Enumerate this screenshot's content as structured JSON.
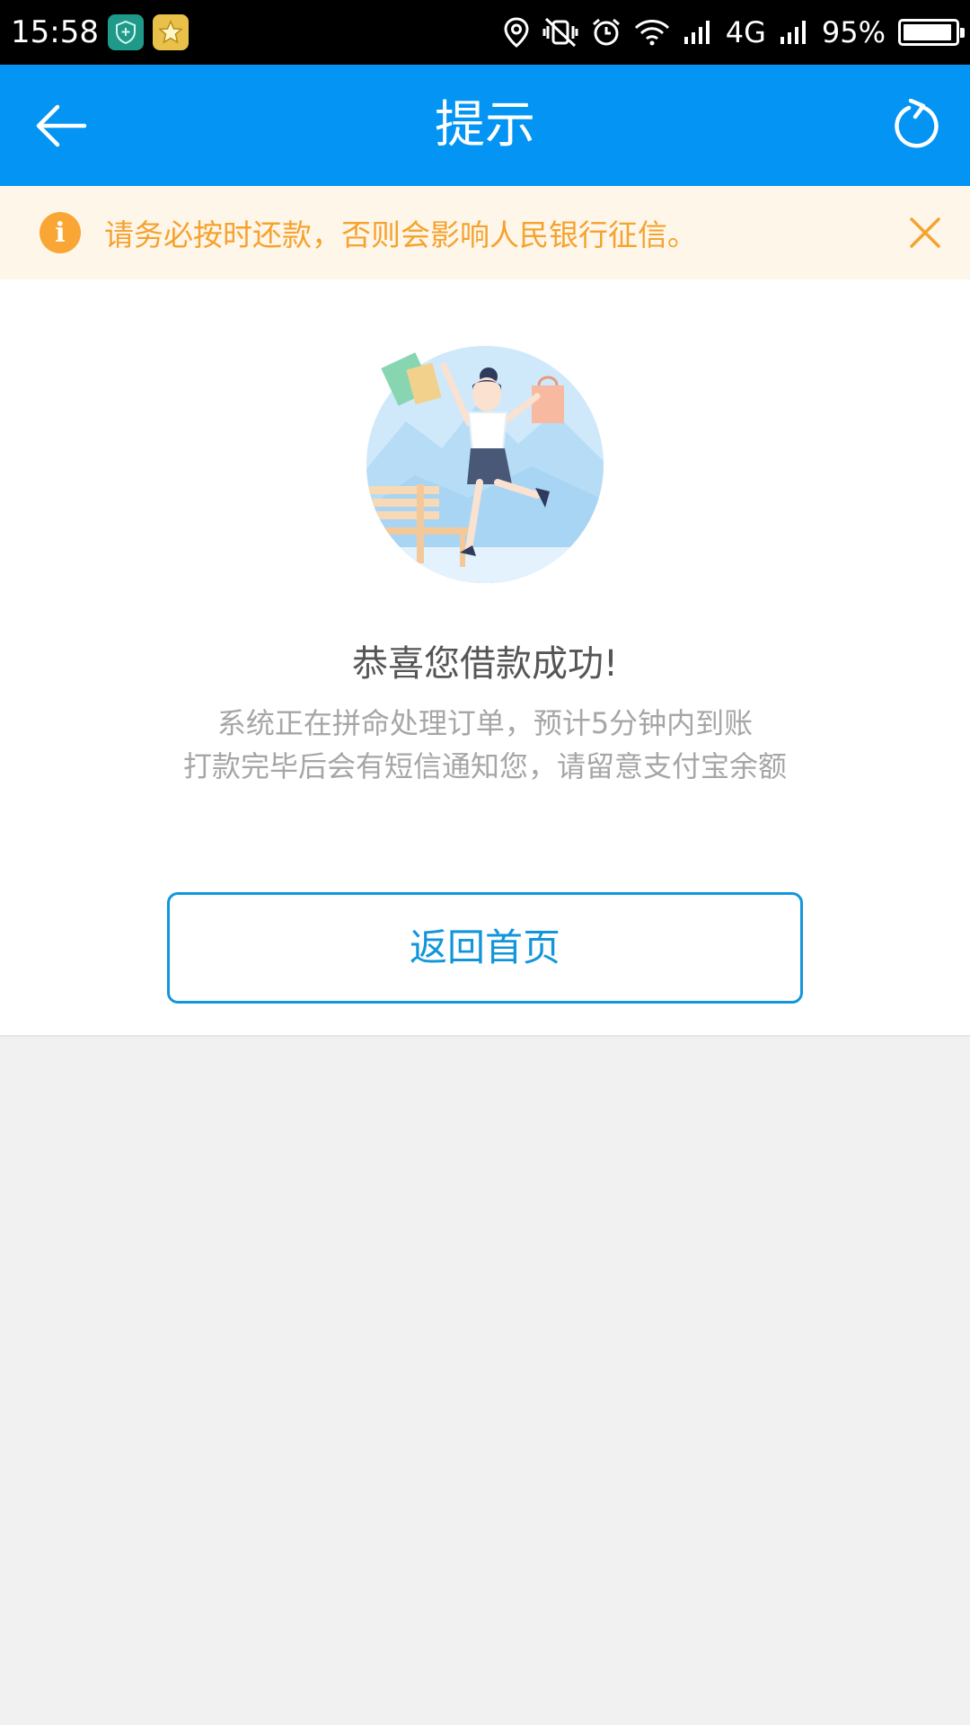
{
  "status_bar": {
    "time": "15:58",
    "network": "4G",
    "battery_text": "95%",
    "battery_level": 0.95,
    "icons": [
      "shield-app-icon",
      "star-app-icon",
      "location-icon",
      "vibrate-off-icon",
      "alarm-icon",
      "wifi-icon",
      "signal-icon",
      "signal-icon"
    ]
  },
  "app_bar": {
    "title": "提示",
    "back_icon": "arrow-left-icon",
    "refresh_icon": "refresh-icon"
  },
  "notice": {
    "icon": "info-icon",
    "icon_glyph": "i",
    "text": "请务必按时还款，否则会影响人民银行征信。",
    "close_icon": "close-icon"
  },
  "result": {
    "title": "恭喜您借款成功!",
    "line1": "系统正在拼命处理订单，预计5分钟内到账",
    "line2": "打款完毕后会有短信通知您，请留意支付宝余额"
  },
  "actions": {
    "home_label": "返回首页"
  },
  "colors": {
    "primary": "#0394f4",
    "notice_bg": "#fff6ea",
    "notice_text": "#f5a22e",
    "button_accent": "#1296db"
  }
}
